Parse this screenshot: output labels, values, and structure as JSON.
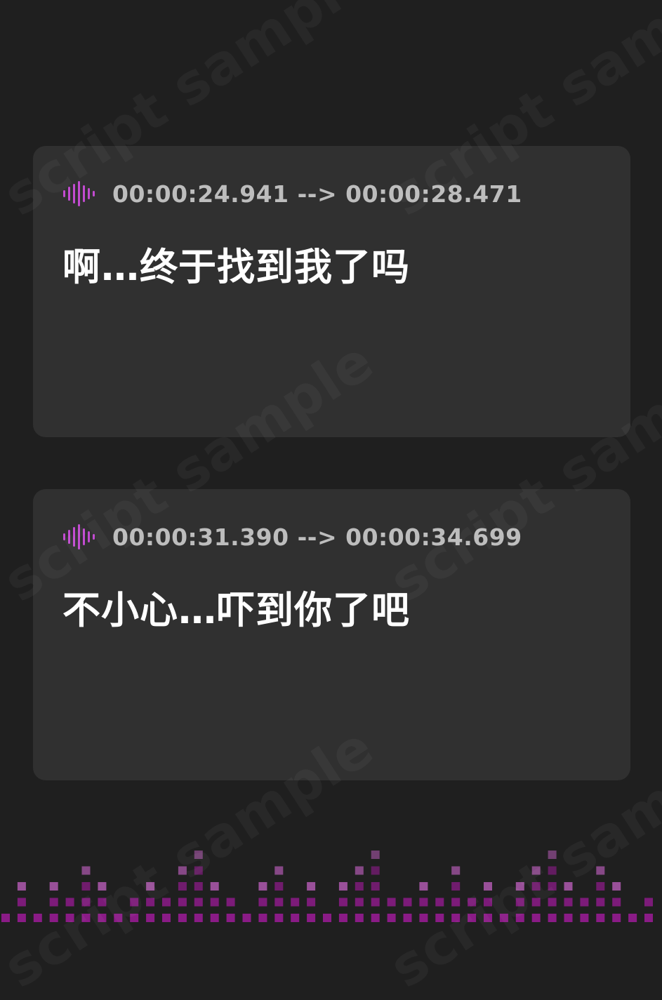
{
  "colors": {
    "background": "#1f1f1f",
    "card": "#303030",
    "timestamp_text": "#bdbdbd",
    "subtitle_text": "#ffffff",
    "accent_dark": "#8a1b86",
    "accent_light": "#c060c0"
  },
  "watermark": {
    "text": "script sample"
  },
  "cues": [
    {
      "icon": "audio-wave-icon",
      "timestamp": "00:00:24.941 --> 00:00:28.471",
      "text": "啊…终于找到我了吗"
    },
    {
      "icon": "audio-wave-icon",
      "timestamp": "00:00:31.390 --> 00:00:34.699",
      "text": "不小心…吓到你了吧"
    }
  ]
}
